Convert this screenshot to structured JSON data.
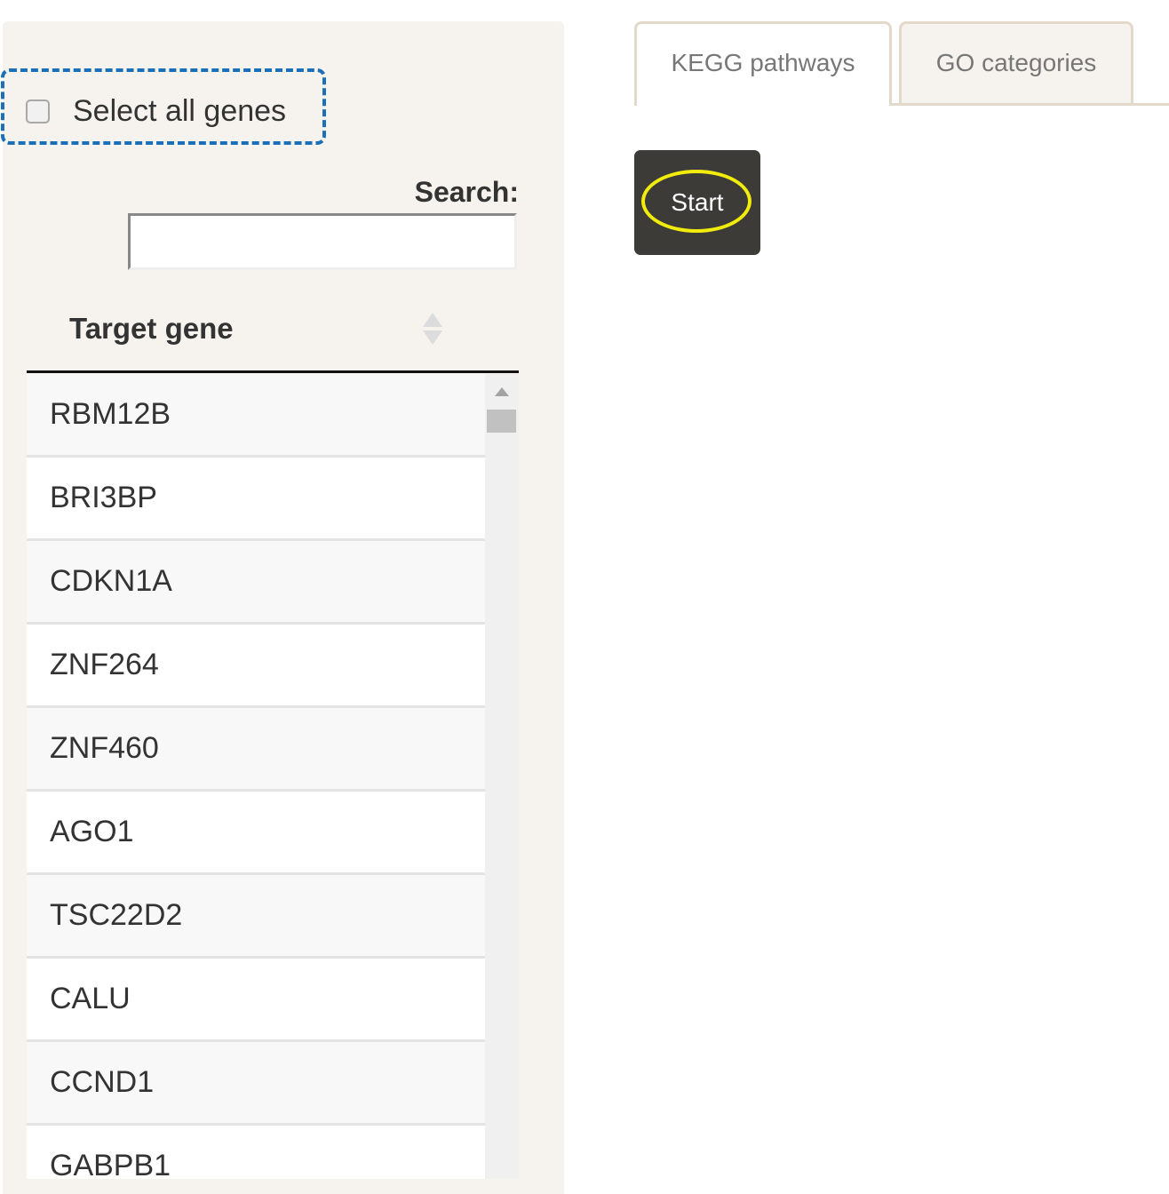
{
  "sidebar": {
    "select_all_label": "Select all genes",
    "select_all_checked": false,
    "search_label": "Search:",
    "search_value": "",
    "table": {
      "column_header": "Target gene",
      "rows": [
        "RBM12B",
        "BRI3BP",
        "CDKN1A",
        "ZNF264",
        "ZNF460",
        "AGO1",
        "TSC22D2",
        "CALU",
        "CCND1",
        "GABPB1"
      ]
    }
  },
  "tabs": [
    {
      "label": "KEGG pathways",
      "active": true
    },
    {
      "label": "GO categories",
      "active": false
    }
  ],
  "main": {
    "start_label": "Start"
  },
  "colors": {
    "panel_background": "#f6f3ee",
    "annotation_dashed_box": "#1a6fb8",
    "annotation_ring": "#f2ec0c",
    "button_background": "#3c3b37"
  },
  "icons": [
    "checkbox-icon",
    "sort-icon",
    "scroll-up-arrow-icon"
  ]
}
